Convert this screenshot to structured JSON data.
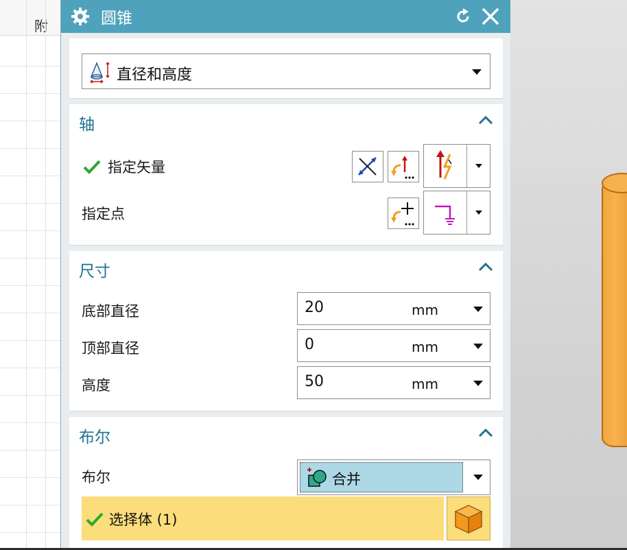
{
  "background": {
    "left_column_header": "附"
  },
  "dialog": {
    "title": "圆锥",
    "title_icon": "gear-icon",
    "actions": [
      "reset-icon",
      "close-icon"
    ],
    "type_dropdown": {
      "value": "直径和高度",
      "icon": "cone-diameter-height-icon"
    }
  },
  "axis_section": {
    "title": "轴",
    "specify_vector": {
      "label": "指定矢量",
      "status": "complete"
    },
    "specify_point": {
      "label": "指定点"
    }
  },
  "dimensions_section": {
    "title": "尺寸",
    "rows": [
      {
        "label": "底部直径",
        "value": "20",
        "unit": "mm"
      },
      {
        "label": "顶部直径",
        "value": "0",
        "unit": "mm"
      },
      {
        "label": "高度",
        "value": "50",
        "unit": "mm"
      }
    ]
  },
  "boolean_section": {
    "title": "布尔",
    "label": "布尔",
    "value": "合并",
    "select_body": "选择体 (1)"
  },
  "colors": {
    "title_bar": "#4fa2bb",
    "section_title": "#1e7390",
    "selection_highlight": "#fbdd7c",
    "boolean_value_bg": "#add8e6",
    "check_green": "#2ea82e"
  }
}
